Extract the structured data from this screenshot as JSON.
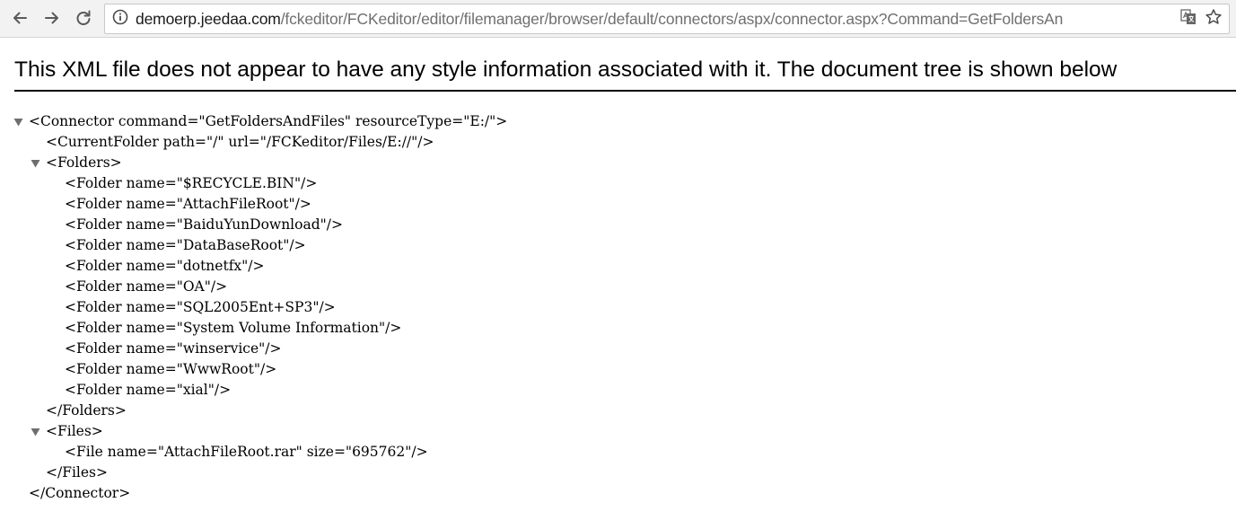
{
  "browser": {
    "url_host": "demoerp.jeedaa.com",
    "url_path": "/fckeditor/FCKeditor/editor/filemanager/browser/default/connectors/aspx/connector.aspx?Command=GetFoldersAn",
    "icons": [
      "back-arrow-icon",
      "forward-arrow-icon",
      "reload-icon",
      "info-icon",
      "translate-icon",
      "star-icon"
    ]
  },
  "xml_viewer": {
    "header": "This XML file does not appear to have any style information associated with it. The document tree is shown below",
    "lines": [
      {
        "text": "<Connector command=\"GetFoldersAndFiles\" resourceType=\"E:/\">",
        "collapsible": true
      },
      {
        "text": "<CurrentFolder path=\"/\" url=\"/FCKeditor/Files/E://\"/>",
        "collapsible": false
      },
      {
        "text": "<Folders>",
        "collapsible": true
      },
      {
        "text": "<Folder name=\"$RECYCLE.BIN\"/>",
        "collapsible": false
      },
      {
        "text": "<Folder name=\"AttachFileRoot\"/>",
        "collapsible": false
      },
      {
        "text": "<Folder name=\"BaiduYunDownload\"/>",
        "collapsible": false
      },
      {
        "text": "<Folder name=\"DataBaseRoot\"/>",
        "collapsible": false
      },
      {
        "text": "<Folder name=\"dotnetfx\"/>",
        "collapsible": false
      },
      {
        "text": "<Folder name=\"OA\"/>",
        "collapsible": false
      },
      {
        "text": "<Folder name=\"SQL2005Ent+SP3\"/>",
        "collapsible": false
      },
      {
        "text": "<Folder name=\"System Volume Information\"/>",
        "collapsible": false
      },
      {
        "text": "<Folder name=\"winservice\"/>",
        "collapsible": false
      },
      {
        "text": "<Folder name=\"WwwRoot\"/>",
        "collapsible": false
      },
      {
        "text": "<Folder name=\"xial\"/>",
        "collapsible": false
      },
      {
        "text": "</Folders>",
        "collapsible": false
      },
      {
        "text": "<Files>",
        "collapsible": true
      },
      {
        "text": "<File name=\"AttachFileRoot.rar\" size=\"695762\"/>",
        "collapsible": false
      },
      {
        "text": "</Files>",
        "collapsible": false
      },
      {
        "text": "</Connector>",
        "collapsible": false
      }
    ]
  }
}
